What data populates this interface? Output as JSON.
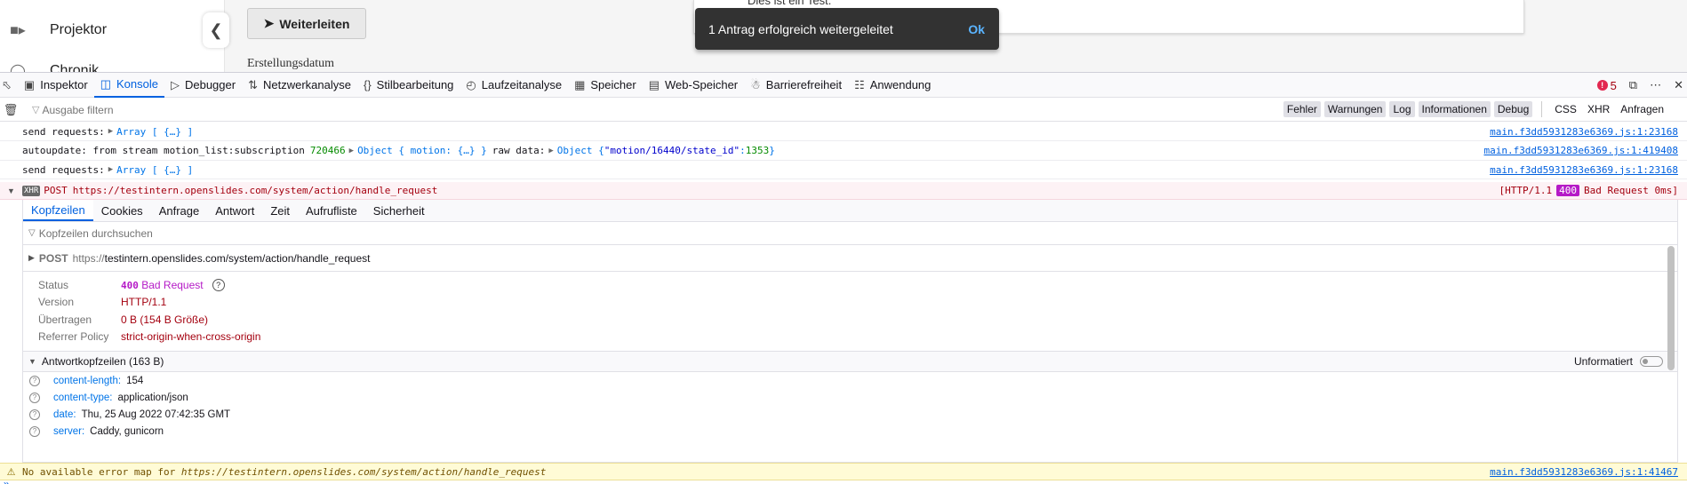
{
  "app": {
    "sidebar": {
      "projector_label": "Projektor",
      "next_label_partial": "Chronik"
    },
    "forward_button": "Weiterleiten",
    "creation_date_label": "Erstellungsdatum",
    "dialog_partial_text": "Dies ist ein Test.",
    "snackbar": {
      "message": "1 Antrag erfolgreich weitergeleitet",
      "action": "Ok"
    }
  },
  "devtools": {
    "tabs": [
      {
        "label": "Inspektor",
        "icon": "inspector-icon"
      },
      {
        "label": "Konsole",
        "icon": "console-icon"
      },
      {
        "label": "Debugger",
        "icon": "debugger-icon"
      },
      {
        "label": "Netzwerkanalyse",
        "icon": "network-icon"
      },
      {
        "label": "Stilbearbeitung",
        "icon": "style-editor-icon"
      },
      {
        "label": "Laufzeitanalyse",
        "icon": "performance-icon"
      },
      {
        "label": "Speicher",
        "icon": "memory-icon"
      },
      {
        "label": "Web-Speicher",
        "icon": "storage-icon"
      },
      {
        "label": "Barrierefreiheit",
        "icon": "accessibility-icon"
      },
      {
        "label": "Anwendung",
        "icon": "application-icon"
      }
    ],
    "active_tab": "Konsole",
    "error_count": "5",
    "filter_placeholder": "Ausgabe filtern",
    "levels": [
      "Fehler",
      "Warnungen",
      "Log",
      "Informationen",
      "Debug"
    ],
    "extra_filters": [
      "CSS",
      "XHR",
      "Anfragen"
    ],
    "console": {
      "rows": [
        {
          "prefix": "send requests:",
          "obj": "Array [ {…} ]",
          "source": "main.f3dd5931283e6369.js:1:23168"
        },
        {
          "prefix": "autoupdate: from stream motion_list:subscription",
          "num": "720466",
          "obj": "Object { motion: {…} }",
          "mid": "raw data:",
          "obj2_pre": "Object { ",
          "obj2_key": "\"motion/16440/state_id\"",
          "obj2_sep": ": ",
          "obj2_val": "1353",
          "obj2_post": " }",
          "source": "main.f3dd5931283e6369.js:1:419408"
        },
        {
          "prefix": "send requests:",
          "obj": "Array [ {…} ]",
          "source": "main.f3dd5931283e6369.js:1:23168"
        }
      ],
      "xhr": {
        "badge": "XHR",
        "method": "POST",
        "url": "https://testintern.openslides.com/system/action/handle_request",
        "status_pre": "[HTTP/1.1",
        "status_code": "400",
        "status_post": "Bad Request 0ms]"
      },
      "warning": {
        "text_pre": "No available error map for ",
        "url": "https://testintern.openslides.com/system/action/handle_request",
        "source": "main.f3dd5931283e6369.js:1:41467"
      },
      "prompt": "»"
    },
    "network_details": {
      "tabs": [
        "Kopfzeilen",
        "Cookies",
        "Anfrage",
        "Antwort",
        "Zeit",
        "Aufrufliste",
        "Sicherheit"
      ],
      "active_tab": "Kopfzeilen",
      "filter_placeholder": "Kopfzeilen durchsuchen",
      "summary": {
        "method": "POST",
        "scheme_host": "https://",
        "host": "testintern.openslides.com",
        "path": "/system/action/handle_request"
      },
      "status": [
        {
          "key": "Status",
          "code": "400",
          "value": "Bad Request"
        },
        {
          "key": "Version",
          "value": "HTTP/1.1"
        },
        {
          "key": "Übertragen",
          "value": "0 B (154 B Größe)"
        },
        {
          "key": "Referrer Policy",
          "value": "strict-origin-when-cross-origin"
        }
      ],
      "response_headers_title": "Antwortkopfzeilen (163 B)",
      "raw_label": "Unformatiert",
      "response_headers": [
        {
          "name": "content-length:",
          "value": "154"
        },
        {
          "name": "content-type:",
          "value": "application/json"
        },
        {
          "name": "date:",
          "value": "Thu, 25 Aug 2022 07:42:35 GMT"
        },
        {
          "name": "server:",
          "value": "Caddy, gunicorn"
        }
      ]
    }
  }
}
